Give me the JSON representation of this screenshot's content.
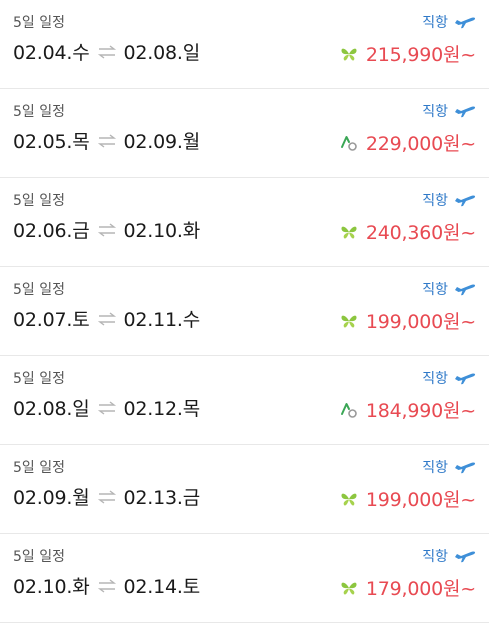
{
  "icons": {
    "swap": "round-trip-arrows-icon",
    "plane": "airplane-icon",
    "airline_a": "butterfly-airline-logo-icon",
    "airline_b": "leaf-circle-airline-logo-icon"
  },
  "colors": {
    "price": "#e84a52",
    "direct": "#2f79c8",
    "plane": "#3e8fd8",
    "butterfly": "#8cc63f",
    "leaf": "#3aa655"
  },
  "items": [
    {
      "duration": "5일 일정",
      "depart": "02.04.수",
      "return": "02.08.일",
      "direct_label": "직항",
      "airline_logo": "butterfly",
      "price": "215,990원~"
    },
    {
      "duration": "5일 일정",
      "depart": "02.05.목",
      "return": "02.09.월",
      "direct_label": "직항",
      "airline_logo": "leaf",
      "price": "229,000원~"
    },
    {
      "duration": "5일 일정",
      "depart": "02.06.금",
      "return": "02.10.화",
      "direct_label": "직항",
      "airline_logo": "butterfly",
      "price": "240,360원~"
    },
    {
      "duration": "5일 일정",
      "depart": "02.07.토",
      "return": "02.11.수",
      "direct_label": "직항",
      "airline_logo": "butterfly",
      "price": "199,000원~"
    },
    {
      "duration": "5일 일정",
      "depart": "02.08.일",
      "return": "02.12.목",
      "direct_label": "직항",
      "airline_logo": "leaf",
      "price": "184,990원~"
    },
    {
      "duration": "5일 일정",
      "depart": "02.09.월",
      "return": "02.13.금",
      "direct_label": "직항",
      "airline_logo": "butterfly",
      "price": "199,000원~"
    },
    {
      "duration": "5일 일정",
      "depart": "02.10.화",
      "return": "02.14.토",
      "direct_label": "직항",
      "airline_logo": "butterfly",
      "price": "179,000원~"
    }
  ]
}
